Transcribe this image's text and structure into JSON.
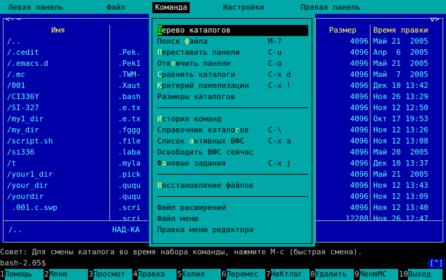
{
  "menubar": {
    "items": [
      "Левая панель",
      "Файл",
      "Команда",
      "Настройки",
      "Правая панель"
    ],
    "active": "Команда"
  },
  "left_panel": {
    "header_name": "Имя",
    "corner_left": "<-",
    "corner_right": "~",
    "bottom_name": "/..",
    "bottom_label": "НАД-КА",
    "files": [
      {
        "name": "/..",
        "ext": ""
      },
      {
        "name": "/.cedit",
        "ext": ".Pek."
      },
      {
        "name": "/.emacs.d",
        "ext": ".Pek1"
      },
      {
        "name": "/.mc",
        "ext": ".TWM-"
      },
      {
        "name": "/001",
        "ext": ".Xaut"
      },
      {
        "name": "/CI336Y",
        "ext": ".bash"
      },
      {
        "name": "/SI-327",
        "ext": ".e.tx"
      },
      {
        "name": "/my1_dir",
        "ext": ".e.tx"
      },
      {
        "name": "/my_dir",
        "ext": ".fggg"
      },
      {
        "name": "/script.sh",
        "ext": ".file"
      },
      {
        "name": "/si336",
        "ext": ".laba"
      },
      {
        "name": "/t",
        "ext": ".myla"
      },
      {
        "name": "/your1_dir",
        "ext": ".pick"
      },
      {
        "name": "/your_dir",
        "ext": ".ququ"
      },
      {
        "name": "/yourdir",
        "ext": ".ququ"
      },
      {
        "name": " .001.c.swp",
        "ext": ".scri"
      },
      {
        "name": "",
        "ext": ".scri"
      }
    ]
  },
  "right_panel": {
    "corner_right": "v>",
    "header_size": "Размер",
    "header_time": "Время правки",
    "rows": [
      {
        "size": "4096",
        "time": "Май 21  2005"
      },
      {
        "size": "4096",
        "time": "Апр  6  2005"
      },
      {
        "size": "4096",
        "time": "Май 21  2005"
      },
      {
        "size": "4096",
        "time": "Май  7  2005"
      },
      {
        "size": "4096",
        "time": "Дек 10 13:42"
      },
      {
        "size": "4096",
        "time": "Ноя 26 13:29"
      },
      {
        "size": "4096",
        "time": "Ноя 12 12:50"
      },
      {
        "size": "4096",
        "time": "Окт 17 19:53"
      },
      {
        "size": "4096",
        "time": "Ноя 12 13:26"
      },
      {
        "size": "4096",
        "time": "Ноя 12 13:08"
      },
      {
        "size": "4096",
        "time": "Май 20  2005"
      },
      {
        "size": "4096",
        "time": "Дек 10 13:37"
      },
      {
        "size": "4096",
        "time": "Май 21  2005"
      },
      {
        "size": "4096",
        "time": "Ноя 12 13:43"
      },
      {
        "size": "4096",
        "time": "Ноя 12 13:09"
      },
      {
        "size": "4096",
        "time": "Ноя 12 13:40"
      },
      {
        "size": "12288",
        "time": "Ноя 26 12:47"
      }
    ]
  },
  "command_menu": {
    "groups": [
      [
        {
          "hk": "Д",
          "rest": "ерево каталогов",
          "shortcut": ""
        },
        {
          "pre": "Поиск ",
          "hk": "ф",
          "rest": "айла",
          "shortcut": "M-?"
        },
        {
          "hk": "П",
          "rest": "ереставить панели",
          "shortcut": "C-u"
        },
        {
          "pre": "Отк",
          "hk": "л",
          "rest": "ючить панели",
          "shortcut": "C-o"
        },
        {
          "hk": "С",
          "rest": "равнить каталоги",
          "shortcut": "C-x d"
        },
        {
          "hk": "К",
          "rest": "ритерий панелизации",
          "shortcut": "C-x !"
        },
        {
          "pre": "Размеры каталогов",
          "hk": "",
          "rest": "",
          "shortcut": ""
        }
      ],
      [
        {
          "hk": "И",
          "rest": "стория команд",
          "shortcut": ""
        },
        {
          "pre": "Справочник катало",
          "hk": "г",
          "rest": "ов",
          "shortcut": "C-\\"
        },
        {
          "pre": "Список ",
          "hk": "а",
          "rest": "ктивных ВФС",
          "shortcut": "C-x a"
        },
        {
          "pre": "Освободить ВФС сейчас",
          "hk": "",
          "rest": "",
          "shortcut": ""
        },
        {
          "pre": "Ф",
          "hk": "о",
          "rest": "новые задания",
          "shortcut": "C-x j"
        }
      ],
      [
        {
          "hk": "В",
          "rest": "осстановление файлов",
          "shortcut": ""
        }
      ],
      [
        {
          "pre": "Файл расширений",
          "hk": "",
          "rest": "",
          "shortcut": ""
        },
        {
          "pre": "Файл меню",
          "hk": "",
          "rest": "",
          "shortcut": ""
        },
        {
          "pre": "Правка меню редактора",
          "hk": "",
          "rest": "",
          "shortcut": ""
        }
      ]
    ]
  },
  "hint": "Совет: Для смены каталога во время набора команды, нажмите M-c (быстрая смена).",
  "prompt": "bash-2.05$",
  "prompt_marker": "[^]",
  "fkeys": [
    {
      "num": "1",
      "label": "Помощь"
    },
    {
      "num": "2",
      "label": "Меню"
    },
    {
      "num": "3",
      "label": "Просмот"
    },
    {
      "num": "4",
      "label": "Правка"
    },
    {
      "num": "5",
      "label": "Копия"
    },
    {
      "num": "6",
      "label": "Перемес"
    },
    {
      "num": "7",
      "label": "НвКтлог"
    },
    {
      "num": "8",
      "label": "Удалить"
    },
    {
      "num": "9",
      "label": "МенюМС"
    },
    {
      "num": "10",
      "label": "Выход"
    }
  ],
  "colors": {
    "panel_bg": "#0000a8",
    "panel_text": "#55ffff",
    "menu_bg": "#00a8a8",
    "hotkey": "#ffff55",
    "selected_hotkey_bg": "#00ff00"
  }
}
